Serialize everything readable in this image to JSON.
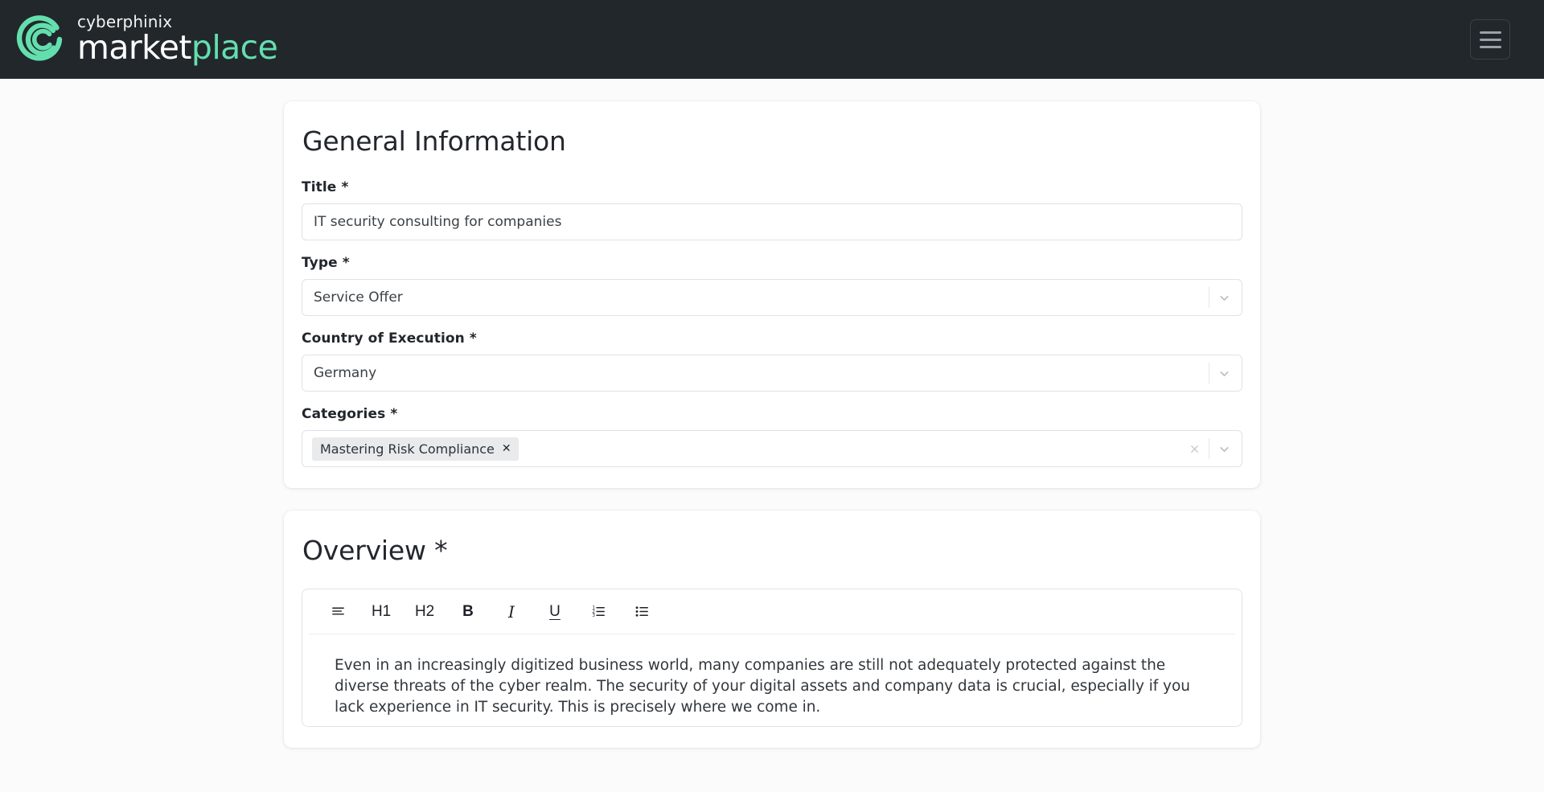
{
  "header": {
    "brand_top": "cyberphinix",
    "brand_word1": "market",
    "brand_word2": "place",
    "logo_icon": "cyberphinix-spiral-c-logo",
    "menu_icon": "hamburger-menu-icon",
    "background_color": "#22272c",
    "accent_color": "#63dfae"
  },
  "general_information": {
    "title": "General Information",
    "fields": {
      "title": {
        "label": "Title",
        "required_marker": "*",
        "value": "IT security consulting for companies"
      },
      "type": {
        "label": "Type",
        "required_marker": "*",
        "value": "Service Offer",
        "chevron_icon": "chevron-down-icon"
      },
      "country": {
        "label": "Country of Execution",
        "required_marker": "*",
        "value": "Germany",
        "chevron_icon": "chevron-down-icon"
      },
      "categories": {
        "label": "Categories",
        "required_marker": "*",
        "tags": [
          {
            "label": "Mastering Risk Compliance",
            "remove_icon": "x-icon"
          }
        ],
        "clear_icon": "clear-x-icon",
        "chevron_icon": "chevron-down-icon"
      }
    }
  },
  "overview": {
    "title": "Overview",
    "required_marker": "*",
    "toolbar": [
      {
        "name": "paragraph-align-icon",
        "label": "",
        "kind": "icon"
      },
      {
        "name": "heading-1-button",
        "label": "H1",
        "kind": "text"
      },
      {
        "name": "heading-2-button",
        "label": "H2",
        "kind": "text"
      },
      {
        "name": "bold-button",
        "label": "B",
        "kind": "bold"
      },
      {
        "name": "italic-button",
        "label": "I",
        "kind": "italic"
      },
      {
        "name": "underline-button",
        "label": "U",
        "kind": "under"
      },
      {
        "name": "ordered-list-icon",
        "label": "",
        "kind": "icon"
      },
      {
        "name": "unordered-list-icon",
        "label": "",
        "kind": "icon"
      }
    ],
    "body_text": "Even in an increasingly digitized business world, many companies are still not adequately protected against the diverse threats of the cyber realm. The security of your digital assets and company data is crucial, especially if you lack experience in IT security. This is precisely where we come in."
  }
}
